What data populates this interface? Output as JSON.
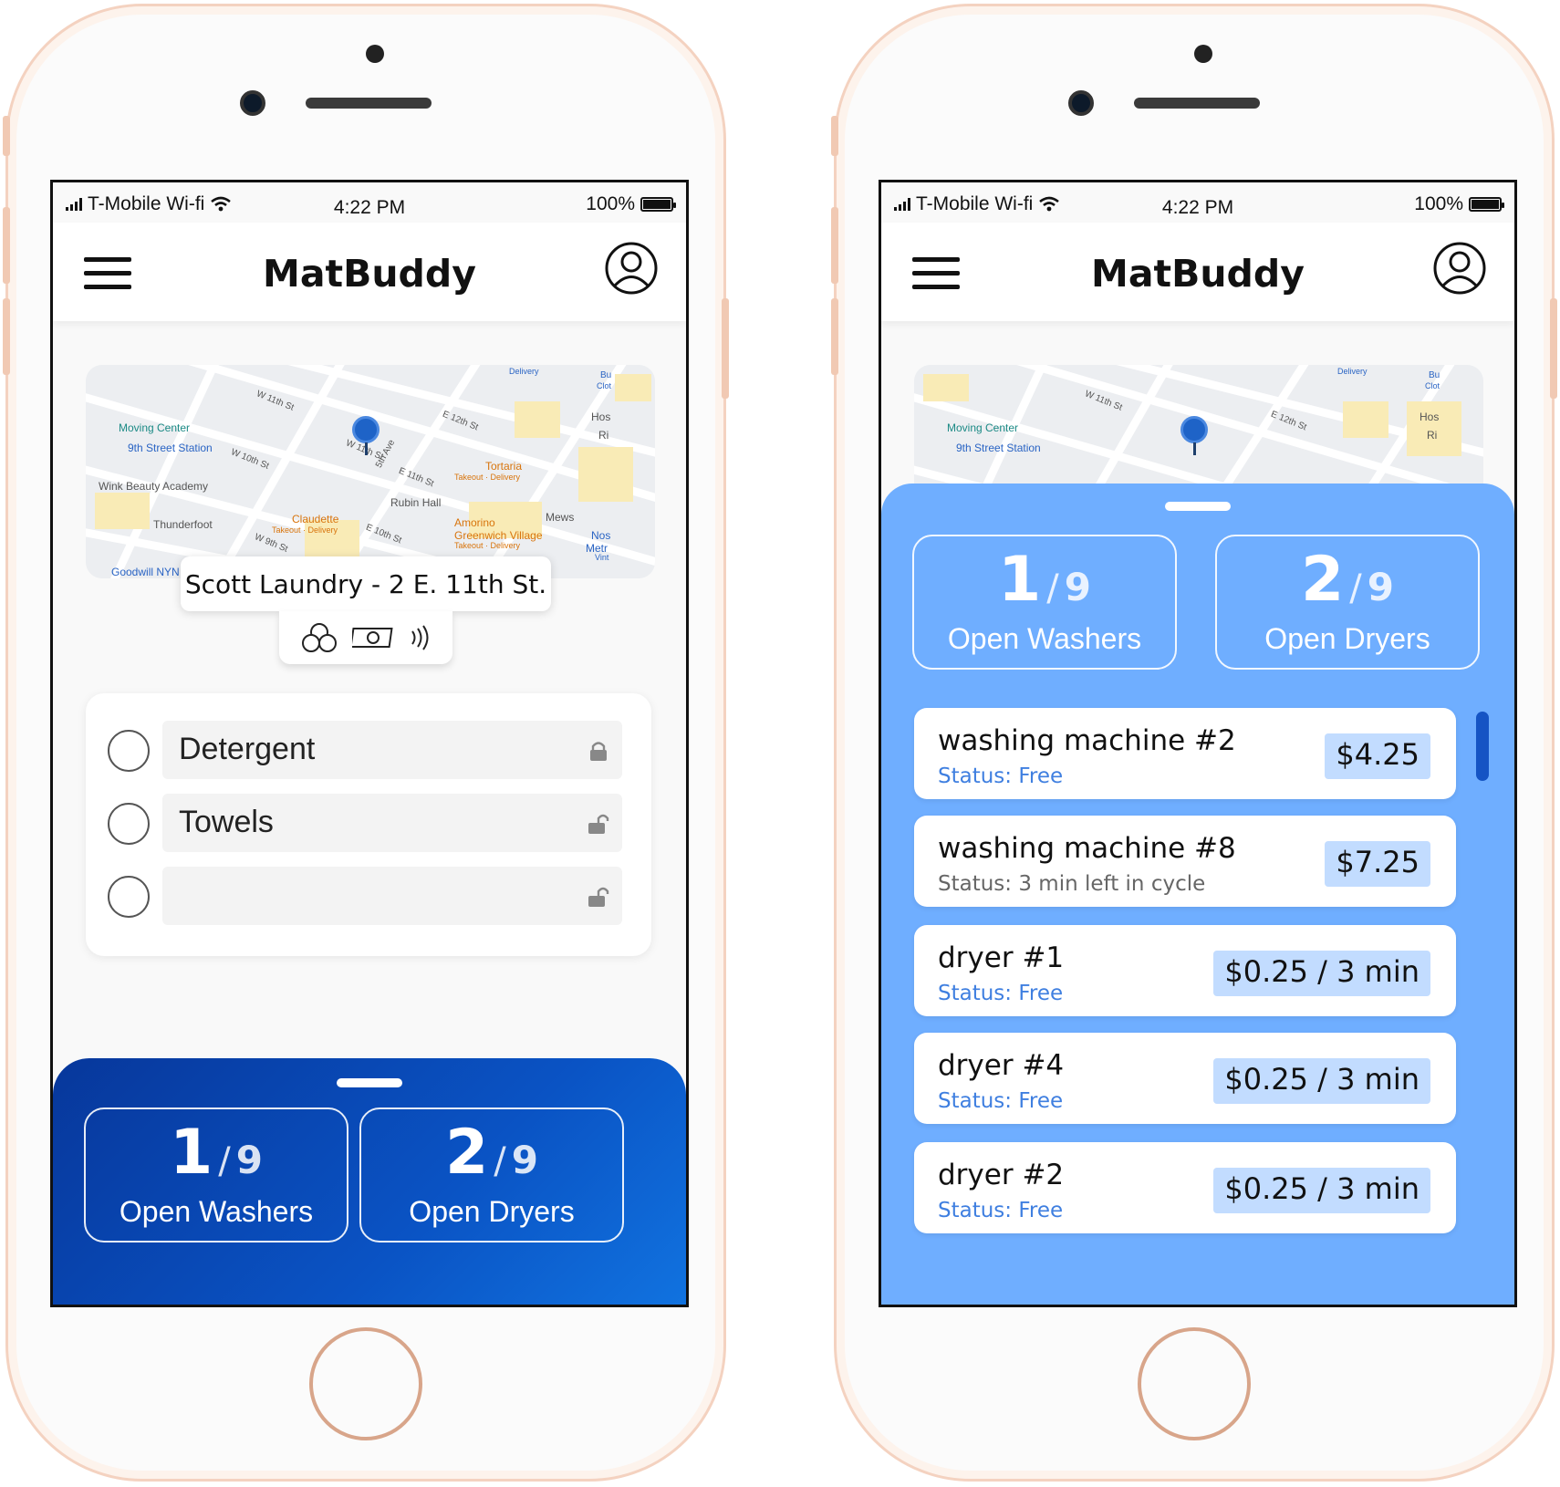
{
  "colors": {
    "accent_dark": "#0a53c4",
    "accent_light": "#6faeff",
    "status_free": "#3f7fe0",
    "status_busy": "#666666",
    "price_bg": "#c2dcff"
  },
  "left_phone": {
    "status_bar": {
      "carrier": "T-Mobile Wi-fi",
      "time": "4:22 PM",
      "battery": "100%"
    },
    "app_bar": {
      "title": "MatBuddy",
      "menu_icon": "hamburger-icon",
      "profile_icon": "user-circle-icon"
    },
    "map": {
      "labels": [
        "Moving Center",
        "9th Street Station",
        "Wink Beauty Academy",
        "Thunderfoot",
        "Goodwill NYN",
        "Claudette",
        "Takeout · Delivery",
        "W 11th St",
        "W 10th St",
        "W 11th St",
        "5th Ave",
        "E 11th St",
        "E 12th St",
        "E 10th St",
        "W 9th St",
        "Rubin Hall",
        "Tortaria",
        "Takeout · Delivery",
        "Amorino",
        "Greenwich Village",
        "Takeout · Delivery",
        "Mews",
        "Delivery",
        "Hos",
        "Ri",
        "Bu",
        "Clot",
        "Nos",
        "Metr",
        "Vint"
      ]
    },
    "location": {
      "name": "Scott Laundry - 2 E. 11th St.",
      "payment_icons": [
        "coins-icon",
        "cash-icon",
        "contactless-icon"
      ]
    },
    "checklist": [
      {
        "label": "Detergent",
        "lock": "lock-closed-icon"
      },
      {
        "label": "Towels",
        "lock": "lock-open-icon"
      },
      {
        "label": "",
        "lock": "lock-open-icon"
      }
    ],
    "counts": [
      {
        "num": "1",
        "sep": "/",
        "total": "9",
        "label": "Open Washers"
      },
      {
        "num": "2",
        "sep": "/",
        "total": "9",
        "label": "Open Dryers"
      }
    ]
  },
  "right_phone": {
    "status_bar": {
      "carrier": "T-Mobile Wi-fi",
      "time": "4:22 PM",
      "battery": "100%"
    },
    "app_bar": {
      "title": "MatBuddy"
    },
    "map": {
      "labels": [
        "Moving Center",
        "9th Street Station",
        "W 11th St",
        "E 12th St",
        "Delivery",
        "Hos",
        "Ri",
        "Bu",
        "Clot"
      ]
    },
    "counts": [
      {
        "num": "1",
        "sep": "/",
        "total": "9",
        "label": "Open Washers"
      },
      {
        "num": "2",
        "sep": "/",
        "total": "9",
        "label": "Open Dryers"
      }
    ],
    "machines": [
      {
        "name": "washing machine #2",
        "status": "Status: Free",
        "state": "free",
        "price": "$4.25"
      },
      {
        "name": "washing machine #8",
        "status": "Status: 3 min left in cycle",
        "state": "busy",
        "price": "$7.25"
      },
      {
        "name": "dryer #1",
        "status": "Status: Free",
        "state": "free",
        "price": "$0.25 / 3 min"
      },
      {
        "name": "dryer #4",
        "status": "Status: Free",
        "state": "free",
        "price": "$0.25 / 3 min"
      },
      {
        "name": "dryer #2",
        "status": "Status: Free",
        "state": "free",
        "price": "$0.25 / 3 min"
      }
    ]
  }
}
